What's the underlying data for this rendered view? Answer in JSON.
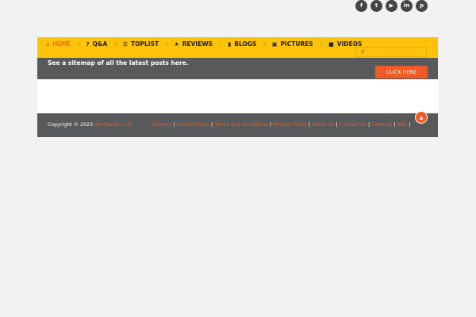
{
  "social": [
    {
      "icon": "facebook-icon",
      "glyph": "f"
    },
    {
      "icon": "twitter-icon",
      "glyph": "t"
    },
    {
      "icon": "youtube-icon",
      "glyph": "▶"
    },
    {
      "icon": "linkedin-icon",
      "glyph": "in"
    },
    {
      "icon": "pinterest-icon",
      "glyph": "p"
    }
  ],
  "nav": {
    "items": [
      {
        "label": "HOME",
        "icon": "home-icon",
        "glyph": "⌂"
      },
      {
        "label": "Q&A",
        "icon": "question-icon",
        "glyph": "?"
      },
      {
        "label": "TOPLIST",
        "icon": "list-icon",
        "glyph": "☰"
      },
      {
        "label": "REVIEWS",
        "icon": "star-icon",
        "glyph": "★"
      },
      {
        "label": "BLOGS",
        "icon": "book-icon",
        "glyph": "▮"
      },
      {
        "label": "PICTURES",
        "icon": "picture-icon",
        "glyph": "▣"
      },
      {
        "label": "VIDEOS",
        "icon": "video-icon",
        "glyph": "■"
      }
    ],
    "separator": "/",
    "search_icon": "⚲",
    "search_placeholder": ""
  },
  "banner": {
    "text": "See a sitemap of all the latest posts here.",
    "button": "CLICK HERE"
  },
  "footer": {
    "copyright_prefix": "Copyright © 2023",
    "site": "worldweb.co.kr",
    "links": [
      "Careers",
      "Cookie Policy",
      "Terms and Conditions",
      "Privacy Policy",
      "About Us",
      "Contact Us",
      "Sitemap",
      "XML"
    ],
    "link_separator": "|",
    "totop_glyph": "▲"
  },
  "colors": {
    "nav_bg": "#fdc30a",
    "accent": "#f15a24",
    "dark": "#58595b"
  }
}
